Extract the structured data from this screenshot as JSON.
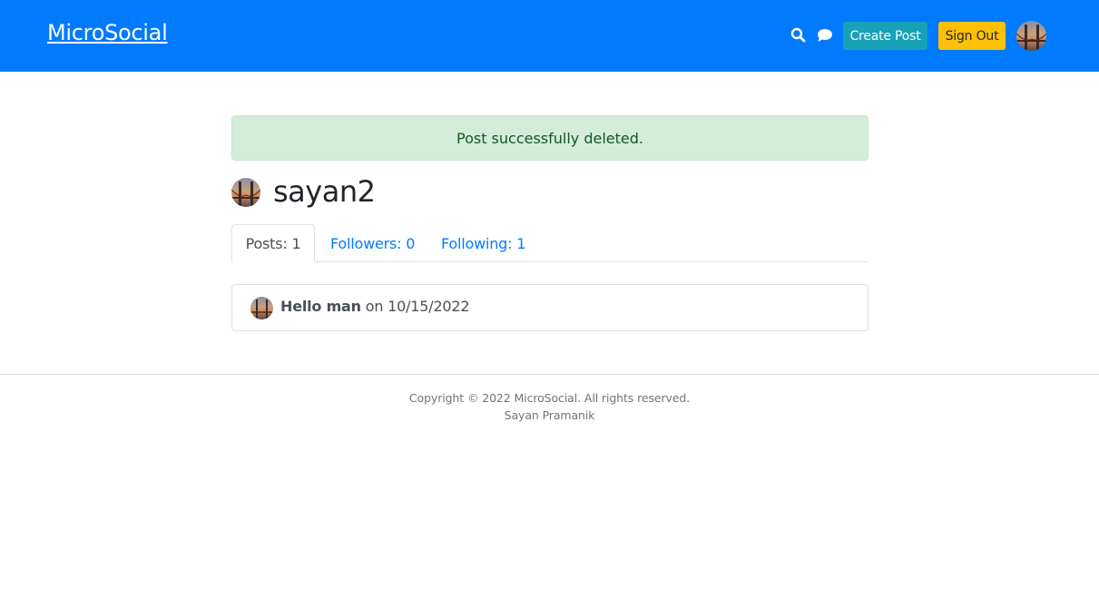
{
  "header": {
    "brand": "MicroSocial",
    "search_icon": "search-icon",
    "chat_icon": "chat-icon",
    "create_post_label": "Create Post",
    "sign_out_label": "Sign Out",
    "colors": {
      "header_bg": "#007bff",
      "create_btn": "#17a2b8",
      "signout_btn": "#ffc107"
    }
  },
  "alert": {
    "message": "Post successfully deleted.",
    "color": "#d4edda"
  },
  "profile": {
    "username": "sayan2",
    "tabs": [
      {
        "label": "Posts: 1",
        "active": true
      },
      {
        "label": "Followers: 0",
        "active": false
      },
      {
        "label": "Following: 1",
        "active": false
      }
    ]
  },
  "posts": [
    {
      "title": "Hello man",
      "date_prefix": "on",
      "date": "10/15/2022"
    }
  ],
  "footer": {
    "copyright": "Copyright © 2022 MicroSocial. All rights reserved.",
    "author": "Sayan Pramanik"
  }
}
